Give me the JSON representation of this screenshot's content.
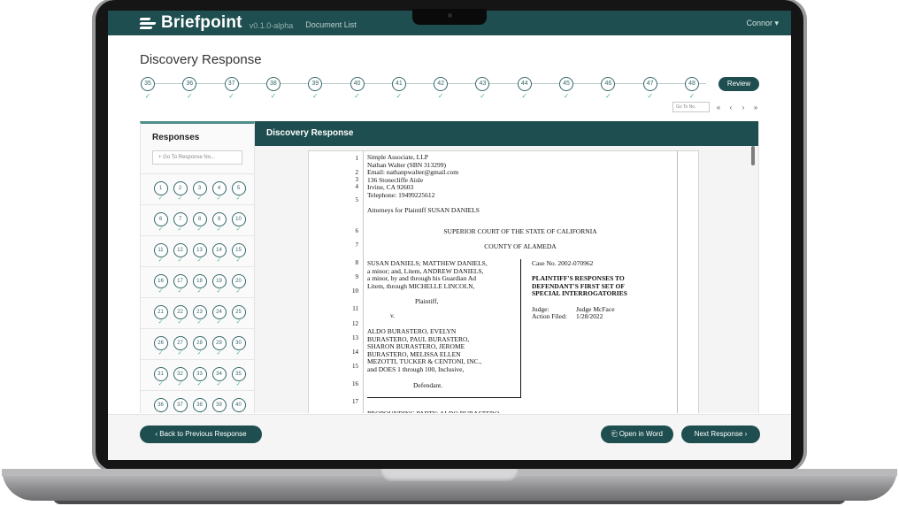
{
  "app": {
    "brand": "Briefpoint",
    "version": "v0.1.0-alpha",
    "nav_link": "Document List",
    "user": "Connor ▾"
  },
  "page": {
    "title": "Discovery Response"
  },
  "stepper": {
    "steps": [
      "35",
      "36",
      "37",
      "38",
      "39",
      "40",
      "41",
      "42",
      "43",
      "44",
      "45",
      "46",
      "47",
      "48"
    ],
    "check": "✓",
    "review_label": "Review",
    "goto_placeholder": "Go To No.",
    "pager": [
      "«",
      "‹",
      "›",
      "»"
    ]
  },
  "sidebar": {
    "title": "Responses",
    "search_placeholder": "+ Go To Response No...",
    "rows": [
      [
        "1",
        "2",
        "3",
        "4",
        "5"
      ],
      [
        "6",
        "7",
        "8",
        "9",
        "10"
      ],
      [
        "11",
        "12",
        "13",
        "14",
        "15"
      ],
      [
        "16",
        "17",
        "18",
        "19",
        "20"
      ],
      [
        "21",
        "22",
        "23",
        "24",
        "25"
      ],
      [
        "26",
        "27",
        "28",
        "29",
        "30"
      ],
      [
        "31",
        "32",
        "33",
        "34",
        "35"
      ],
      [
        "36",
        "37",
        "38",
        "39",
        "40"
      ]
    ]
  },
  "main": {
    "header": "Discovery Response"
  },
  "document": {
    "line_numbers": [
      "1",
      "2",
      "3",
      "4",
      "5",
      "6",
      "7",
      "8",
      "9",
      "10",
      "11",
      "12",
      "13",
      "14",
      "15",
      "16",
      "17"
    ],
    "attorney_block": [
      "Simple Associate, LLP",
      "Nathan Walter (SBN 313299)",
      "Email: nathanpwalter@gmail.com",
      "136 Stonecliffe Aisle",
      "Irvine, CA 92603",
      "Telephone: 19499225612"
    ],
    "attorneys_for": "Attorneys for Plaintiff SUSAN DANIELS",
    "court": "SUPERIOR COURT OF THE STATE OF CALIFORNIA",
    "county": "COUNTY OF ALAMEDA",
    "plaintiffs": [
      "SUSAN DANIELS; MATTHEW DANIELS,",
      "a minor; and, Litem, ANDREW DANIELS,",
      "a minor, by and through his Guardian Ad",
      "Litem, through MICHELLE LINCOLN,"
    ],
    "plaintiff_label": "Plaintiff,",
    "versus": "v.",
    "defendants": [
      "ALDO BURASTERO, EVELYN",
      "BURASTERO, PAUL BURASTERO,",
      "SHARON BURASTERO, JEROME",
      "BURASTERO, MELISSA ELLEN",
      "MEZOTTI, TUCKER & CENTONI, INC.,",
      "and DOES 1 through 100, Inclusive,"
    ],
    "defendant_label": "Defendant.",
    "case_no": "Case No. 2002-070962",
    "doc_title": [
      "PLAINTIFF'S RESPONSES TO",
      "DEFENDANT'S FIRST SET OF",
      "SPECIAL INTERROGATORIES"
    ],
    "judge_label": "Judge:",
    "judge_value": "Judge McFace",
    "filed_label": "Action Filed:",
    "filed_value": "1/28/2022",
    "cut_line": "PROPOUNDING PARTY:     ALDO BURASTERO"
  },
  "footer": {
    "back_label": "‹  Back to Previous Response",
    "word_label": "⎗ Open in Word",
    "next_label": "Next Response  ›"
  }
}
